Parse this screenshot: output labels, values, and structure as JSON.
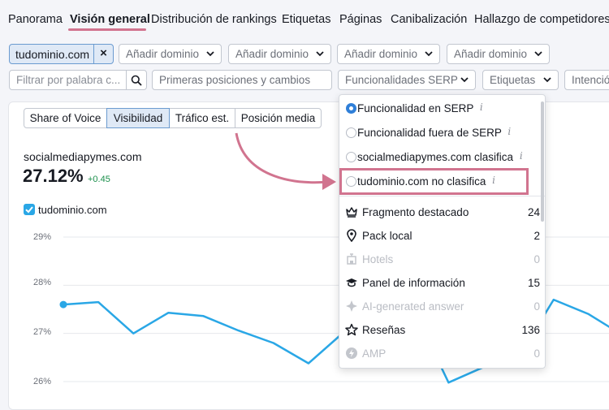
{
  "nav": {
    "items": [
      "Panorama",
      "Visión general",
      "Distribución de rankings",
      "Etiquetas",
      "Páginas",
      "Canibalización",
      "Hallazgo de competidores"
    ],
    "active_index": 1
  },
  "filters": {
    "domain_chip": {
      "label": "tudominio.com",
      "remove": "×"
    },
    "add_domain": [
      "Añadir dominio",
      "Añadir dominio",
      "Añadir dominio",
      "Añadir dominio"
    ],
    "keyword_filter_placeholder": "Filtrar por palabra c...",
    "positions_select": "Primeras posiciones y cambios",
    "serp_features_select": "Funcionalidades SERP",
    "tags_select": "Etiquetas",
    "intent_select": "Intenció"
  },
  "metric_tabs": {
    "items": [
      "Share of Voice",
      "Visibilidad",
      "Tráfico est.",
      "Posición media"
    ],
    "selected_index": 1
  },
  "summary": {
    "domain": "socialmediapymes.com",
    "value": "27.12%",
    "delta": "+0.45"
  },
  "legend": {
    "label": "tudominio.com",
    "checked": true
  },
  "dropdown": {
    "radios": [
      {
        "label": "Funcionalidad en SERP",
        "selected": true
      },
      {
        "label": "Funcionalidad fuera de SERP",
        "selected": false
      },
      {
        "label": "socialmediapymes.com clasifica",
        "selected": false
      },
      {
        "label": "tudominio.com no clasifica",
        "selected": false
      }
    ],
    "info_glyph": "i",
    "features": [
      {
        "label": "Fragmento destacado",
        "count": "24",
        "icon": "crown-icon",
        "enabled": true
      },
      {
        "label": "Pack local",
        "count": "2",
        "icon": "map-pin-icon",
        "enabled": true
      },
      {
        "label": "Hotels",
        "count": "0",
        "icon": "hotel-icon",
        "enabled": false
      },
      {
        "label": "Panel de información",
        "count": "15",
        "icon": "graduation-cap-icon",
        "enabled": true
      },
      {
        "label": "AI-generated answer",
        "count": "0",
        "icon": "ai-sparkle-icon",
        "enabled": false
      },
      {
        "label": "Reseñas",
        "count": "136",
        "icon": "star-icon",
        "enabled": true
      },
      {
        "label": "AMP",
        "count": "0",
        "icon": "amp-bolt-icon",
        "enabled": false
      }
    ]
  },
  "chart_data": {
    "type": "line",
    "y_tick_labels": [
      "29%",
      "28%",
      "27%",
      "26%"
    ],
    "ylim": [
      26,
      29
    ],
    "series": [
      {
        "values": [
          27.6,
          27.65,
          27.0,
          27.43,
          27.36,
          27.06,
          26.8,
          26.38,
          27.02,
          26.6,
          27.5,
          25.98,
          26.3,
          26.5,
          27.7,
          27.4,
          26.95
        ]
      }
    ]
  },
  "colors": {
    "accent_pink": "#d1748f",
    "series_blue": "#2aa7e6",
    "selected_blue": "#2f7fd8",
    "positive_green": "#1a8f4b"
  }
}
